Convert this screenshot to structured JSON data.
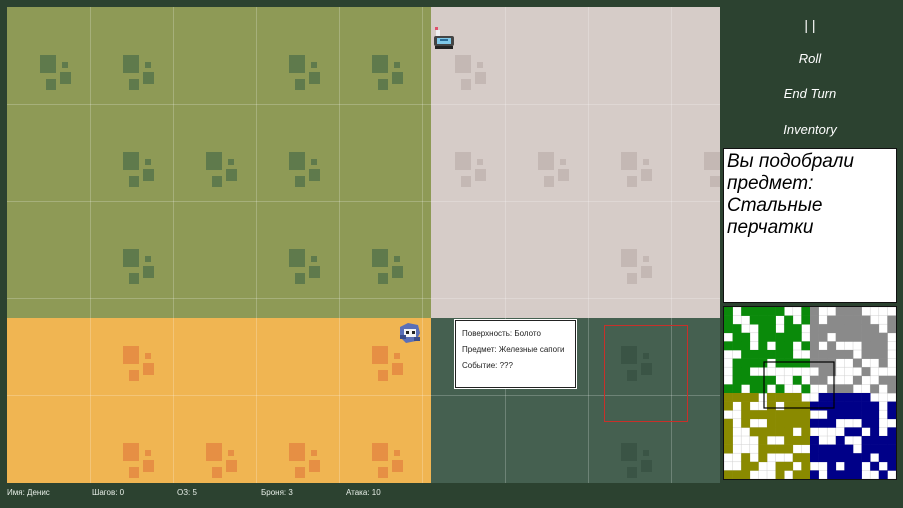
{
  "menu": {
    "pause_label": "| |",
    "roll_label": "Roll",
    "end_turn_label": "End Turn",
    "inventory_label": "Inventory"
  },
  "log": {
    "message": "Вы подобрали предмет: Стальные перчатки"
  },
  "tooltip": {
    "surface": "Поверхность: Болото",
    "item": "Предмет: Железные сапоги",
    "event": "Событие: ???"
  },
  "status": {
    "name": "Имя: Денис",
    "steps": "Шагов: 0",
    "hp": "ОЗ: 5",
    "armor": "Броня: 3",
    "attack": "Атака: 10"
  },
  "colors": {
    "background": "#2c4230",
    "zone_olive": "#8e9a56",
    "zone_stone": "#d6ccc8",
    "zone_desert": "#f0b552",
    "zone_swamp": "#456050",
    "highlight": "#c8302a",
    "minimap_green": "#0a8a0a",
    "minimap_gray": "#8a8a8a",
    "minimap_olive": "#8a8a00",
    "minimap_navy": "#000088"
  },
  "icons": {
    "player_one": "knight-sprite",
    "player_two": "mage-sprite"
  }
}
